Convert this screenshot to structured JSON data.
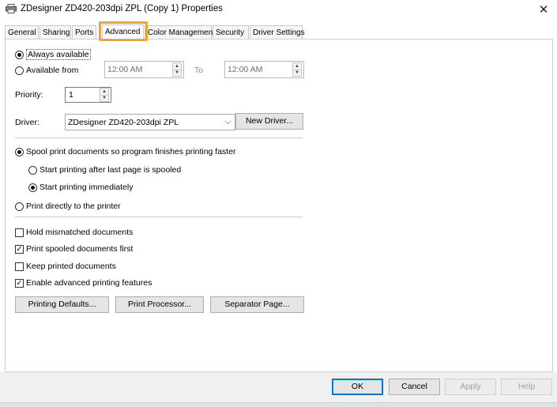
{
  "window": {
    "title": "ZDesigner ZD420-203dpi ZPL (Copy 1) Properties",
    "close_glyph": "✕"
  },
  "tabs": [
    "General",
    "Sharing",
    "Ports",
    "Advanced",
    "Color Management",
    "Security",
    "Driver Settings"
  ],
  "active_tab": "Advanced",
  "availability": {
    "always_label": "Always available",
    "from_label": "Available from",
    "from_time": "12:00 AM",
    "to_label": "To",
    "to_time": "12:00 AM"
  },
  "priority": {
    "label": "Priority:",
    "value": "1"
  },
  "driver": {
    "label": "Driver:",
    "selected": "ZDesigner ZD420-203dpi ZPL",
    "new_driver_button": "New Driver..."
  },
  "spooling": {
    "spool_label": "Spool print documents so program finishes printing faster",
    "after_last_page_label": "Start printing after last page is spooled",
    "immediately_label": "Start printing immediately",
    "direct_label": "Print directly to the printer"
  },
  "options": {
    "hold_mismatched": "Hold mismatched documents",
    "print_spooled_first": "Print spooled documents first",
    "keep_printed": "Keep printed documents",
    "enable_advanced": "Enable advanced printing features"
  },
  "option_state": {
    "hold_mismatched": false,
    "print_spooled_first": true,
    "keep_printed": false,
    "enable_advanced": true
  },
  "action_buttons": {
    "printing_defaults": "Printing Defaults...",
    "print_processor": "Print Processor...",
    "separator_page": "Separator Page..."
  },
  "footer": {
    "ok": "OK",
    "cancel": "Cancel",
    "apply": "Apply",
    "help": "Help"
  },
  "colors": {
    "highlight": "#f2a623",
    "default_button_border": "#0078d7"
  }
}
